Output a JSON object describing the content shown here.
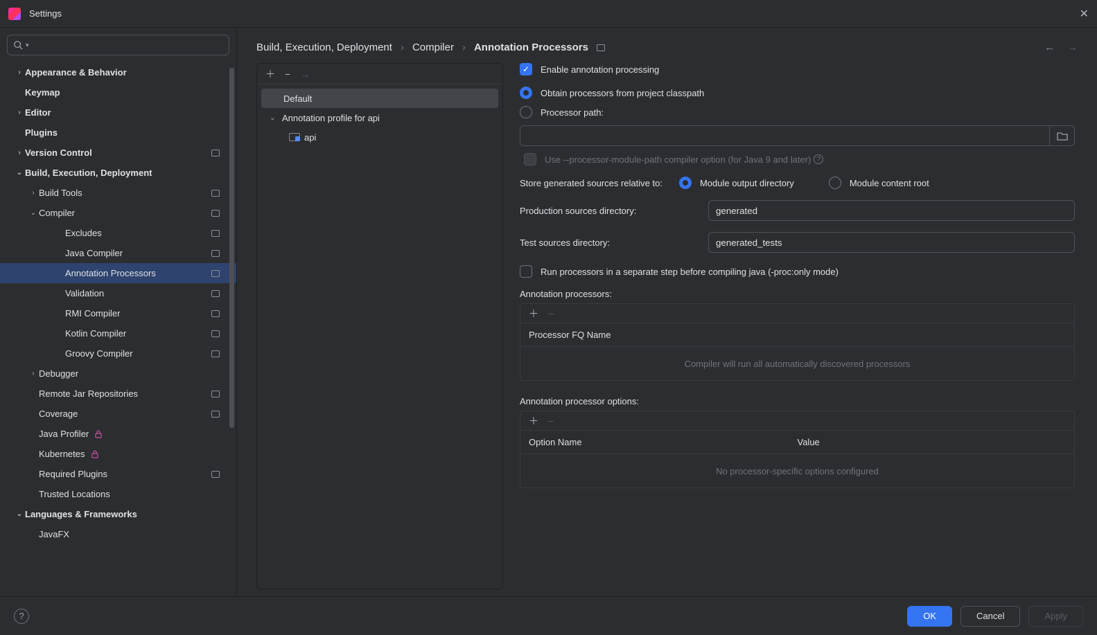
{
  "window": {
    "title": "Settings"
  },
  "search": {
    "placeholder": ""
  },
  "sidebar": [
    {
      "label": "Appearance & Behavior",
      "level": 0,
      "expandable": true,
      "expanded": false
    },
    {
      "label": "Keymap",
      "level": 0
    },
    {
      "label": "Editor",
      "level": 0,
      "expandable": true,
      "expanded": false
    },
    {
      "label": "Plugins",
      "level": 0
    },
    {
      "label": "Version Control",
      "level": 0,
      "expandable": true,
      "expanded": false,
      "badge": true
    },
    {
      "label": "Build, Execution, Deployment",
      "level": 0,
      "expandable": true,
      "expanded": true
    },
    {
      "label": "Build Tools",
      "level": 1,
      "expandable": true,
      "expanded": false,
      "badge": true
    },
    {
      "label": "Compiler",
      "level": 1,
      "expandable": true,
      "expanded": true,
      "badge": true
    },
    {
      "label": "Excludes",
      "level": 2,
      "badge": true
    },
    {
      "label": "Java Compiler",
      "level": 2,
      "badge": true
    },
    {
      "label": "Annotation Processors",
      "level": 2,
      "badge": true,
      "selected": true
    },
    {
      "label": "Validation",
      "level": 2,
      "badge": true
    },
    {
      "label": "RMI Compiler",
      "level": 2,
      "badge": true
    },
    {
      "label": "Kotlin Compiler",
      "level": 2,
      "badge": true
    },
    {
      "label": "Groovy Compiler",
      "level": 2,
      "badge": true
    },
    {
      "label": "Debugger",
      "level": 1,
      "expandable": true,
      "expanded": false
    },
    {
      "label": "Remote Jar Repositories",
      "level": 1,
      "badge": true
    },
    {
      "label": "Coverage",
      "level": 1,
      "badge": true
    },
    {
      "label": "Java Profiler",
      "level": 1,
      "lock": true
    },
    {
      "label": "Kubernetes",
      "level": 1,
      "lock": true
    },
    {
      "label": "Required Plugins",
      "level": 1,
      "badge": true
    },
    {
      "label": "Trusted Locations",
      "level": 1
    },
    {
      "label": "Languages & Frameworks",
      "level": 0,
      "expandable": true,
      "expanded": true
    },
    {
      "label": "JavaFX",
      "level": 1
    }
  ],
  "breadcrumb": {
    "a": "Build, Execution, Deployment",
    "b": "Compiler",
    "c": "Annotation Processors"
  },
  "profiles": {
    "default": "Default",
    "profile": "Annotation profile for api",
    "module": "api"
  },
  "form": {
    "enable": "Enable annotation processing",
    "obtain": "Obtain processors from project classpath",
    "procpath": "Processor path:",
    "usemodpath": "Use --processor-module-path compiler option (for Java 9 and later)",
    "storerel": "Store generated sources relative to:",
    "modout": "Module output directory",
    "modcontent": "Module content root",
    "prodlbl": "Production sources directory:",
    "prodval": "generated",
    "testlbl": "Test sources directory:",
    "testval": "generated_tests",
    "separate": "Run processors in a separate step before compiling java (-proc:only mode)",
    "ap_label": "Annotation processors:",
    "ap_col": "Processor FQ Name",
    "ap_empty": "Compiler will run all automatically discovered processors",
    "opt_label": "Annotation processor options:",
    "opt_col1": "Option Name",
    "opt_col2": "Value",
    "opt_empty": "No processor-specific options configured"
  },
  "footer": {
    "ok": "OK",
    "cancel": "Cancel",
    "apply": "Apply"
  }
}
